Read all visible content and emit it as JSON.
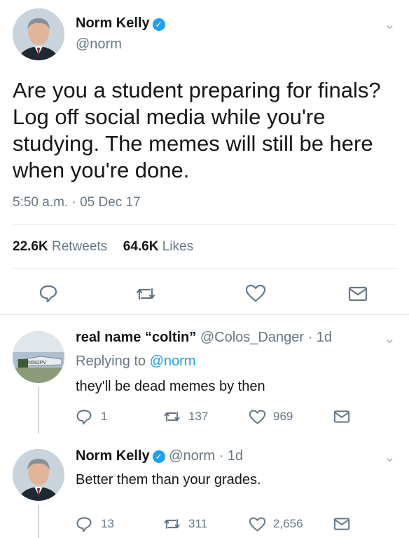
{
  "main_tweet": {
    "author_name": "Norm Kelly",
    "author_handle": "@norm",
    "text": "Are you a student preparing for finals? Log off social media while you're studying. The memes will still be here when you're done.",
    "timestamp": "5:50 a.m. · 05 Dec 17",
    "retweets_count": "22.6K",
    "retweets_label": "Retweets",
    "likes_count": "64.6K",
    "likes_label": "Likes"
  },
  "replies": [
    {
      "author_name": "real name “coltin”",
      "author_handle": "@Colos_Danger",
      "time": "· 1d",
      "replying_to_label": "Replying to",
      "replying_to_handle": "@norm",
      "text": "they'll be dead memes by then",
      "reply_count": "1",
      "retweet_count": "137",
      "like_count": "969"
    },
    {
      "author_name": "Norm Kelly",
      "author_handle": "@norm",
      "time": "· 1d",
      "text": "Better them than your grades.",
      "reply_count": "13",
      "retweet_count": "311",
      "like_count": "2,656"
    }
  ],
  "colors": {
    "accent": "#1da1f2",
    "text": "#14171a",
    "muted": "#657786",
    "divider": "#e1e8ed"
  },
  "icons": [
    "verified-icon",
    "chevron-down-icon",
    "reply-icon",
    "retweet-icon",
    "like-icon",
    "message-icon"
  ]
}
